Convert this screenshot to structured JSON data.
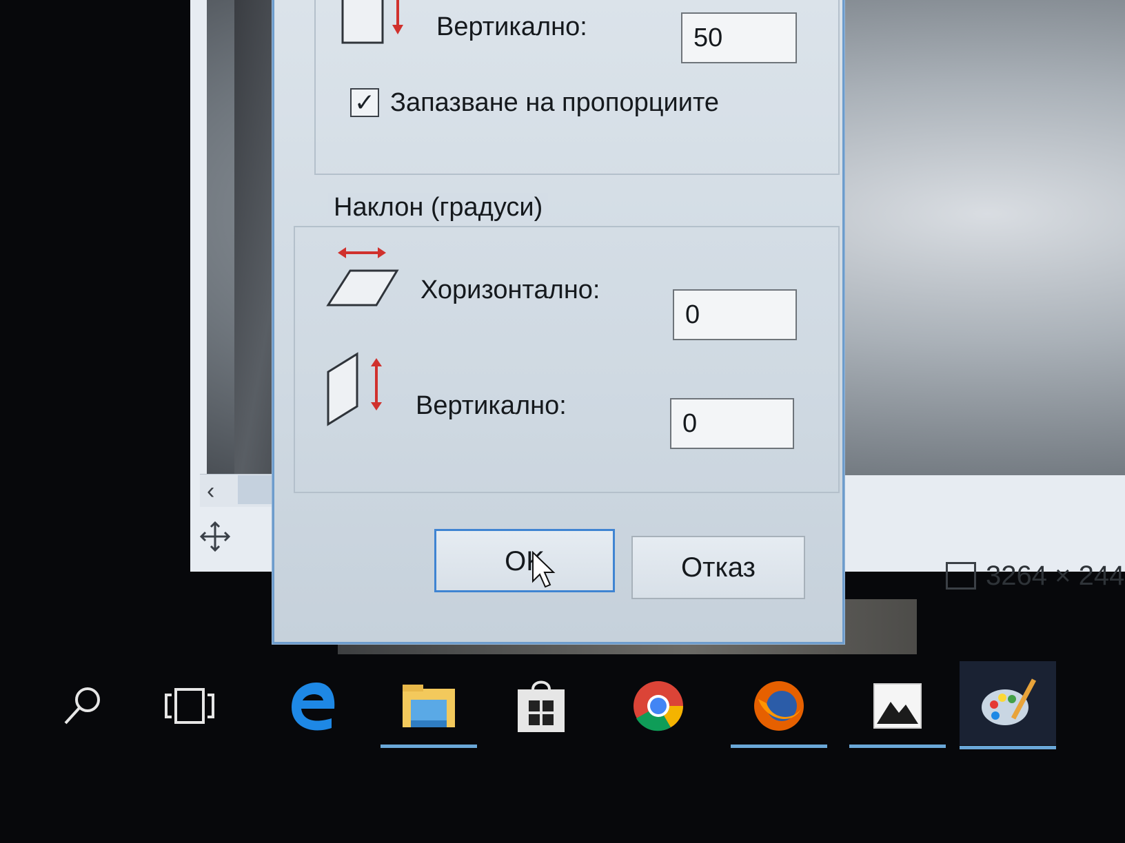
{
  "dialog": {
    "top_group": {
      "vertical_label": "Вертикално:",
      "vertical_value": "50",
      "keep_ratio_label": "Запазване на пропорциите",
      "keep_ratio_checked": true
    },
    "skew_group": {
      "title": "Наклон (градуси)",
      "horizontal_label": "Хоризонтално:",
      "horizontal_value": "0",
      "vertical_label": "Вертикално:",
      "vertical_value": "0"
    },
    "buttons": {
      "ok": "OK",
      "cancel": "Отказ"
    }
  },
  "status_bar": {
    "image_size": "3264 × 244"
  },
  "taskbar": {
    "items": [
      {
        "icon": "search-icon"
      },
      {
        "icon": "task-view-icon"
      },
      {
        "icon": "edge-icon"
      },
      {
        "icon": "file-explorer-icon",
        "running": true
      },
      {
        "icon": "store-icon"
      },
      {
        "icon": "chrome-icon"
      },
      {
        "icon": "firefox-icon",
        "running": true
      },
      {
        "icon": "photos-icon",
        "running": true
      },
      {
        "icon": "paint-icon",
        "running": true,
        "active": true
      }
    ]
  },
  "colors": {
    "accent": "#3f84d2",
    "arrow_red": "#d0312d",
    "taskbar_bg": "#07080b"
  }
}
